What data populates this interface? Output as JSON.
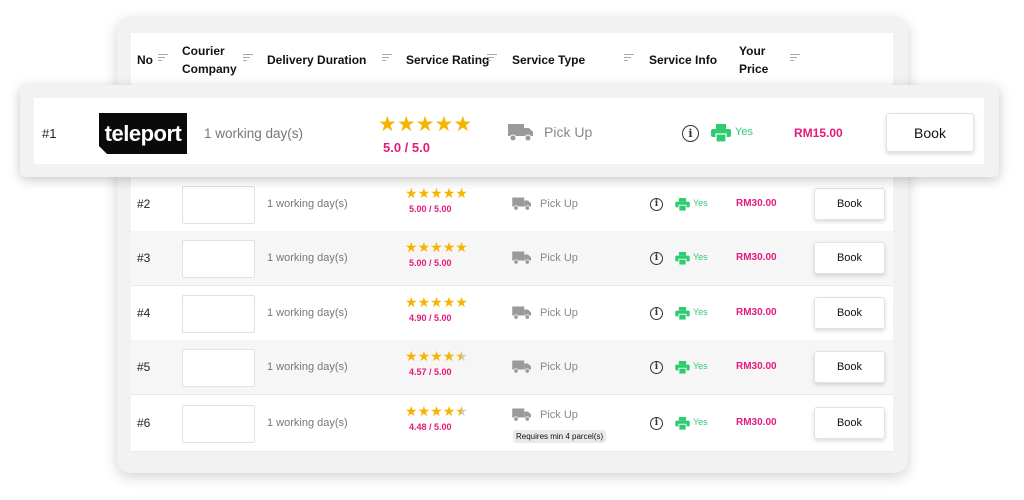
{
  "header": {
    "no": "No",
    "courier": "Courier\nCompany",
    "duration": "Delivery Duration",
    "rating": "Service Rating",
    "type": "Service Type",
    "info": "Service Info",
    "price": "Your\nPrice"
  },
  "featured": {
    "no": "#1",
    "logo_text": "teleport",
    "duration": "1 working day(s)",
    "stars": 5,
    "rating": "5.0 / 5.0",
    "service_type": "Pick Up",
    "info_icon": "info-icon",
    "printer_icon": "printer-icon",
    "print_label": "Yes",
    "price": "RM15.00",
    "book_label": "Book"
  },
  "rows": [
    {
      "no": "#2",
      "duration": "1 working day(s)",
      "stars": 5,
      "rating": "5.00 / 5.00",
      "service_type": "Pick Up",
      "print_label": "Yes",
      "price": "RM30.00",
      "book_label": "Book",
      "note": ""
    },
    {
      "no": "#3",
      "duration": "1 working day(s)",
      "stars": 5,
      "rating": "5.00 / 5.00",
      "service_type": "Pick Up",
      "print_label": "Yes",
      "price": "RM30.00",
      "book_label": "Book",
      "note": ""
    },
    {
      "no": "#4",
      "duration": "1 working day(s)",
      "stars": 5,
      "rating": "4.90 / 5.00",
      "service_type": "Pick Up",
      "print_label": "Yes",
      "price": "RM30.00",
      "book_label": "Book",
      "note": ""
    },
    {
      "no": "#5",
      "duration": "1 working day(s)",
      "stars": 4.5,
      "rating": "4.57 / 5.00",
      "service_type": "Pick Up",
      "print_label": "Yes",
      "price": "RM30.00",
      "book_label": "Book",
      "note": ""
    },
    {
      "no": "#6",
      "duration": "1 working day(s)",
      "stars": 4.5,
      "rating": "4.48 / 5.00",
      "service_type": "Pick Up",
      "print_label": "Yes",
      "price": "RM30.00",
      "book_label": "Book",
      "note": "Requires min 4 parcel(s)"
    }
  ],
  "colors": {
    "accent_pink": "#e5197c",
    "star_gold": "#f5b400",
    "yes_green": "#2ecc71"
  }
}
